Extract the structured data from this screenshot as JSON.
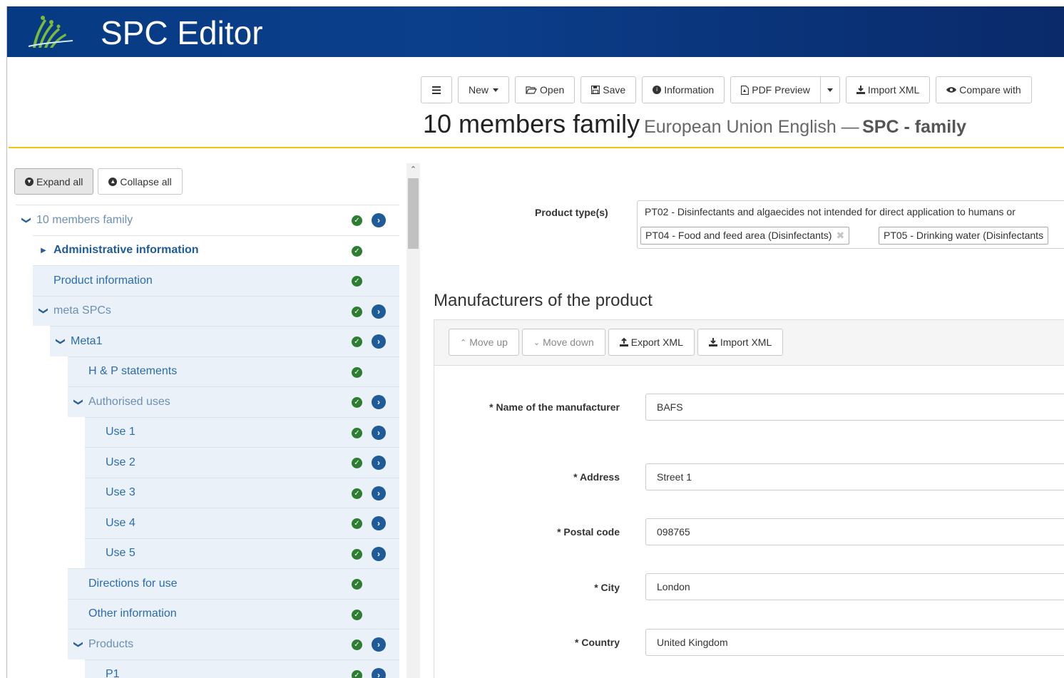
{
  "app": {
    "title": "SPC Editor"
  },
  "toolbar": {
    "menu_icon": "hamburger-menu-icon",
    "new_label": "New",
    "open_label": "Open",
    "save_label": "Save",
    "information_label": "Information",
    "pdf_preview_label": "PDF Preview",
    "import_xml_label": "Import XML",
    "compare_label": "Compare with"
  },
  "document": {
    "title": "10 members family",
    "language": "European Union English —",
    "type": "SPC - family"
  },
  "tree_controls": {
    "expand_all": "Expand all",
    "collapse_all": "Collapse all"
  },
  "tree": [
    {
      "label": "10 members family",
      "expanded": true
    },
    {
      "label": "Administrative information",
      "collapsed": true
    },
    {
      "label": "Product information"
    },
    {
      "label": "meta SPCs",
      "expanded": true
    },
    {
      "label": "Meta1",
      "expanded": true
    },
    {
      "label": "H & P statements"
    },
    {
      "label": "Authorised uses",
      "expanded": true
    },
    {
      "label": "Use 1"
    },
    {
      "label": "Use 2"
    },
    {
      "label": "Use 3"
    },
    {
      "label": "Use 4"
    },
    {
      "label": "Use 5"
    },
    {
      "label": "Directions for use"
    },
    {
      "label": "Other information"
    },
    {
      "label": "Products",
      "expanded": true
    },
    {
      "label": "P1"
    }
  ],
  "product_types": {
    "label": "Product type(s)",
    "tags": [
      "PT02 - Disinfectants and algaecides not intended for direct application to humans or",
      "PT04 - Food and feed area (Disinfectants)",
      "PT05 - Drinking water (Disinfectants"
    ]
  },
  "manufacturers": {
    "title": "Manufacturers of the product",
    "move_up": "Move up",
    "move_down": "Move down",
    "export_xml": "Export XML",
    "import_xml": "Import XML",
    "fields": {
      "name_label": "* Name of the manufacturer",
      "name_value": "BAFS",
      "address_label": "* Address",
      "address_value": "Street 1",
      "postal_label": "* Postal code",
      "postal_value": "098765",
      "city_label": "* City",
      "city_value": "London",
      "country_label": "* Country",
      "country_value": "United Kingdom"
    }
  },
  "colors": {
    "header_blue": "#063a82",
    "accent_gold": "#f0c419",
    "ok_green": "#2e7d32",
    "link_blue": "#2b6cb0"
  }
}
